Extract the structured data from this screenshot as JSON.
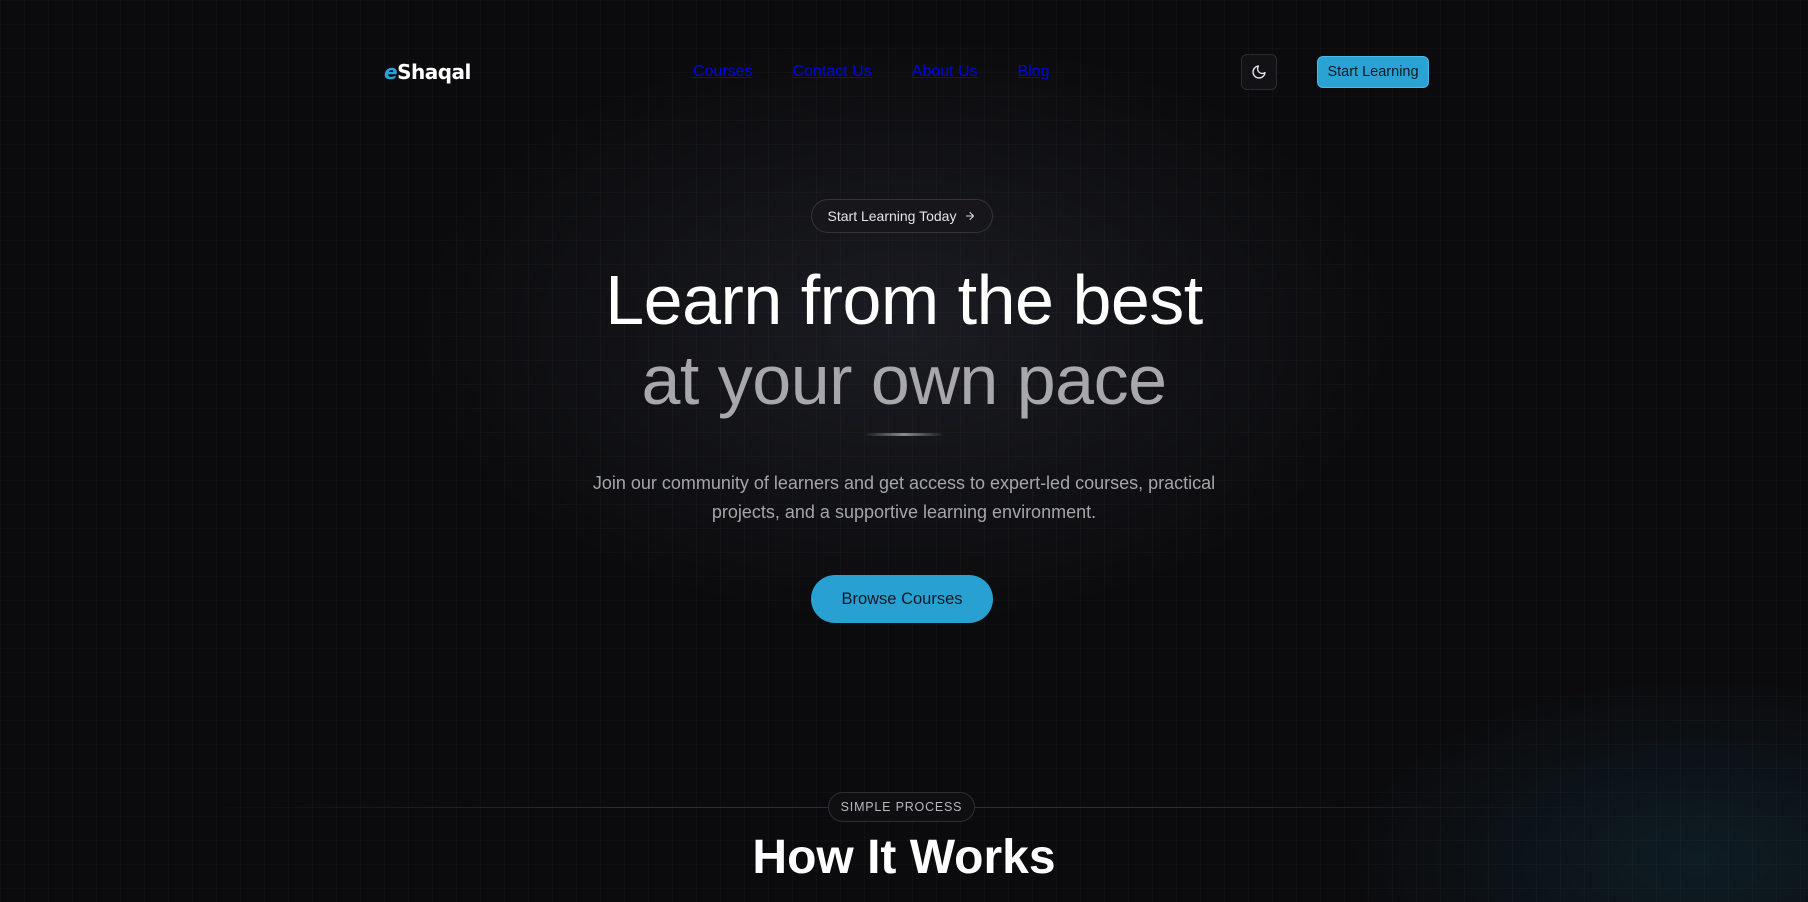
{
  "header": {
    "logo_prefix": "e",
    "logo_name": "Shaqal",
    "nav": [
      "Courses",
      "Contact Us",
      "About Us",
      "Blog"
    ],
    "theme_icon": "moon-icon",
    "cta_label": "Start Learning"
  },
  "hero": {
    "pill_label": "Start Learning Today",
    "pill_icon": "arrow-right-icon",
    "title_line1": "Learn from the best",
    "title_line2": "at your own pace",
    "description": "Join our community of learners and get access to expert-led courses, practical projects, and a supportive learning environment.",
    "button_label": "Browse Courses"
  },
  "section": {
    "badge": "SIMPLE PROCESS",
    "title": "How It Works"
  },
  "colors": {
    "background": "#0b0b0d",
    "accent": "#29a0d2",
    "title_secondary": "#a8a8ac"
  }
}
